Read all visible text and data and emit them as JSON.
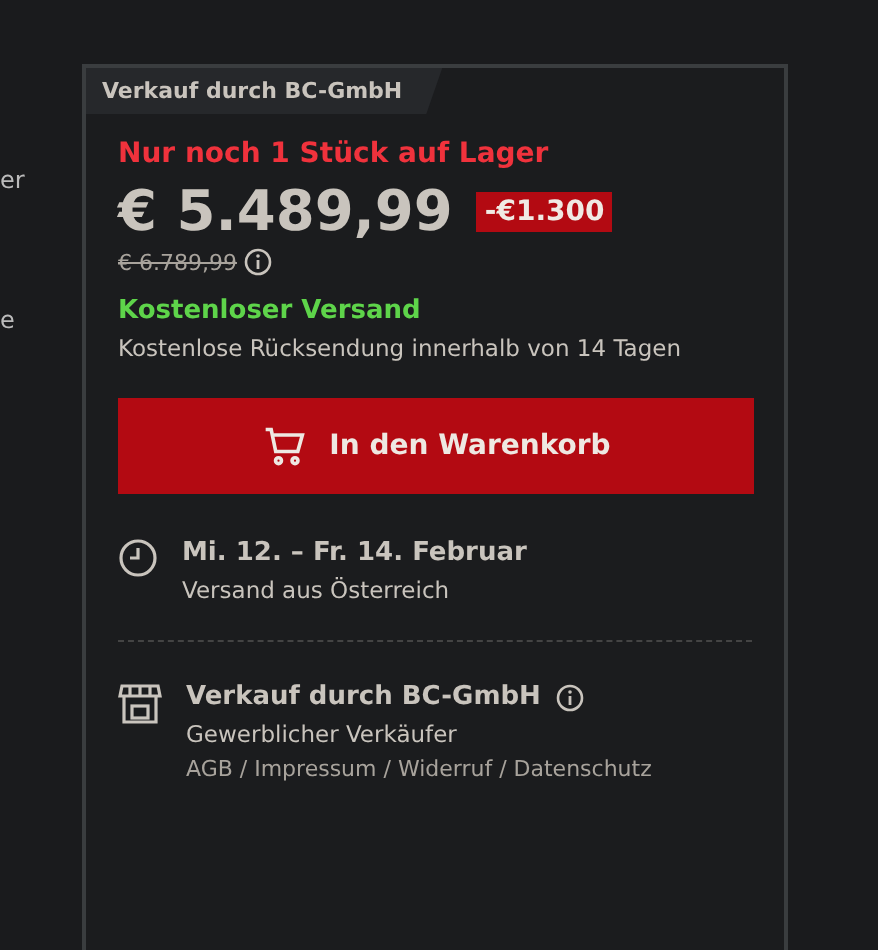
{
  "side_fragments": [
    "er",
    "e"
  ],
  "card": {
    "tab": "Verkauf durch BC-GmbH",
    "stock": "Nur noch 1 Stück auf Lager",
    "price": "€ 5.489,99",
    "discount": "-€1.300",
    "old_price": "€ 6.789,99",
    "shipping": "Kostenloser Versand",
    "returns": "Kostenlose Rücksendung innerhalb von 14 Tagen",
    "cart_button": "In den Warenkorb",
    "delivery": {
      "date": "Mi. 12. – Fr. 14. Februar",
      "origin": "Versand aus Österreich"
    },
    "seller": {
      "name": "Verkauf durch BC-GmbH",
      "type": "Gewerblicher Verkäufer",
      "links": "AGB / Impressum / Widerruf / Datenschutz"
    }
  }
}
